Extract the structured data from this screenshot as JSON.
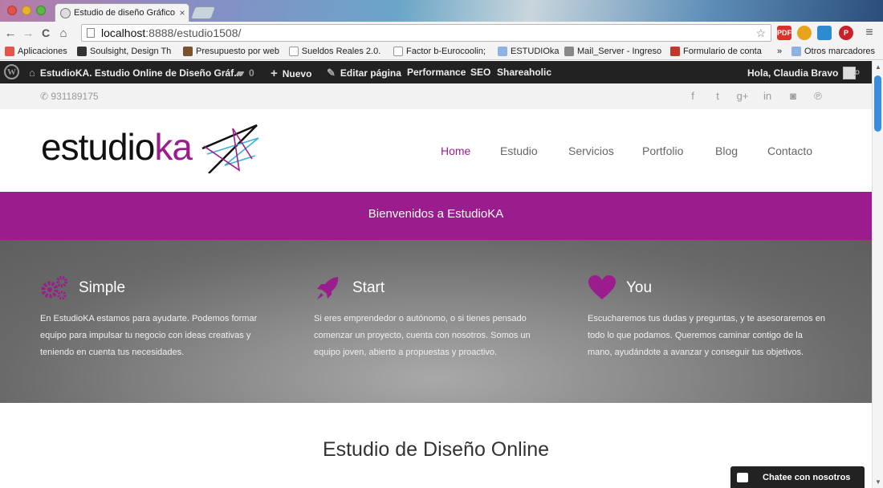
{
  "browser": {
    "tab_title": "Estudio de diseño Gráfico",
    "tab_close": "×",
    "url_host": "localhost",
    "url_path": ":8888/estudio1508/",
    "nav": {
      "back": "←",
      "forward": "→",
      "reload": "C",
      "home": "⌂"
    },
    "omni_icons": "☆",
    "menu_icon": "≡"
  },
  "bookmarks": [
    {
      "label": "Aplicaciones",
      "icon": "apps-grid-icon",
      "color": "#e2574c"
    },
    {
      "label": "Soulsight, Design Th",
      "icon": "soulsight-icon",
      "color": "#333333"
    },
    {
      "label": "Presupuesto por web",
      "icon": "image-icon",
      "color": "#7a5230"
    },
    {
      "label": "Sueldos Reales 2.0. |",
      "icon": "page-icon",
      "color": "#dddddd"
    },
    {
      "label": "Factor b-Eurocoolin;",
      "icon": "page-icon",
      "color": "#dddddd"
    },
    {
      "label": "ESTUDIOka",
      "icon": "folder-icon",
      "color": "#8fb2e2"
    },
    {
      "label": "Mail_Server - Ingreso",
      "icon": "mail-icon",
      "color": "#888888"
    },
    {
      "label": "Formulario de conta",
      "icon": "m-icon",
      "color": "#c0392b"
    },
    {
      "label": "»",
      "icon": "",
      "color": ""
    },
    {
      "label": "Otros marcadores",
      "icon": "folder-icon",
      "color": "#8fb2e2"
    }
  ],
  "adminbar": {
    "logo": "W",
    "site_name": "EstudioKA. Estudio Online de Diseño Gráf...",
    "comments_count": "0",
    "new_label": "Nuevo",
    "edit_label": "Editar página",
    "performance": "Performance",
    "seo": "SEO",
    "shareaholic": "Shareaholic",
    "greeting": "Hola, Claudia Bravo",
    "search_icon": "⌕"
  },
  "topbar": {
    "phone": "931189175",
    "phone_icon": "✆",
    "social": [
      {
        "name": "facebook-icon",
        "glyph": "f"
      },
      {
        "name": "twitter-icon",
        "glyph": "t"
      },
      {
        "name": "google-plus-icon",
        "glyph": "g+"
      },
      {
        "name": "linkedin-icon",
        "glyph": "in"
      },
      {
        "name": "instagram-icon",
        "glyph": "◙"
      },
      {
        "name": "pinterest-icon",
        "glyph": "℗"
      }
    ]
  },
  "header": {
    "logo_main": "estudio",
    "logo_accent": "ka",
    "menu": [
      "Home",
      "Estudio",
      "Servicios",
      "Portfolio",
      "Blog",
      "Contacto"
    ]
  },
  "welcome": "Bienvenidos a EstudioKA",
  "features": [
    {
      "title": "Simple",
      "icon": "gears-icon",
      "text": "En EstudioKA estamos para ayudarte. Podemos formar equipo para impulsar tu negocio con ideas creativas y teniendo en cuenta tus necesidades."
    },
    {
      "title": "Start",
      "icon": "rocket-icon",
      "text": "Si eres emprendedor o autónomo, o si tienes pensado comenzar un proyecto, cuenta con nosotros. Somos un equipo joven, abierto a propuestas y proactivo."
    },
    {
      "title": "You",
      "icon": "heart-icon",
      "text": "Escucharemos tus dudas y preguntas, y te asesoraremos en todo lo que podamos. Queremos caminar contigo de la mano, ayudándote a avanzar y conseguir tus objetivos."
    }
  ],
  "section_title": "Estudio de Diseño Online",
  "chat": "Chatee con nosotros",
  "colors": {
    "accent": "#9b1c8d",
    "adminbar": "#222222",
    "gray_band": "#777777"
  }
}
